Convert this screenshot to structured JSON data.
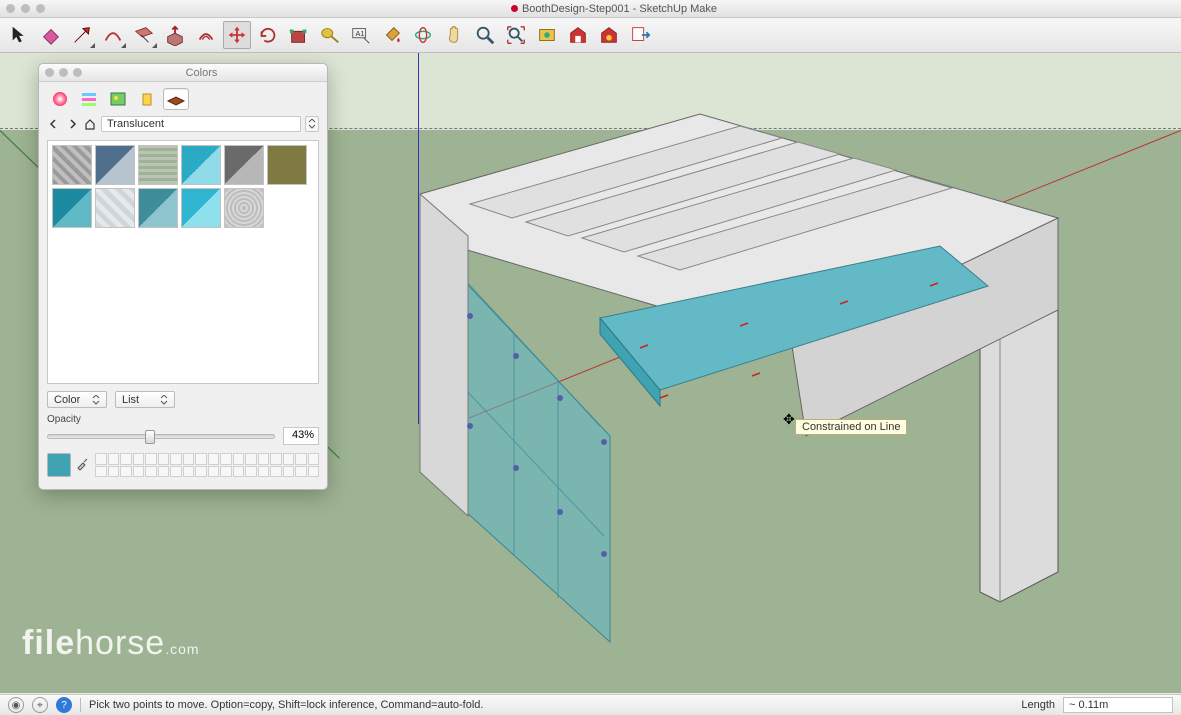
{
  "window": {
    "title": "BoothDesign-Step001 - SketchUp Make"
  },
  "toolbar": {
    "items": [
      {
        "name": "select-tool",
        "icon": "cursor",
        "active": false
      },
      {
        "name": "eraser-tool",
        "icon": "eraser"
      },
      {
        "name": "line-tool",
        "icon": "pencil",
        "corner": true
      },
      {
        "name": "arc-tool",
        "icon": "arc",
        "corner": true
      },
      {
        "name": "rectangle-tool",
        "icon": "rect",
        "corner": true
      },
      {
        "name": "push-pull-tool",
        "icon": "pushpull"
      },
      {
        "name": "offset-tool",
        "icon": "offset"
      },
      {
        "name": "move-tool",
        "icon": "move",
        "active": true
      },
      {
        "name": "rotate-tool",
        "icon": "rotate"
      },
      {
        "name": "scale-tool",
        "icon": "scale"
      },
      {
        "name": "tape-measure-tool",
        "icon": "tape"
      },
      {
        "name": "text-tool",
        "icon": "textA"
      },
      {
        "name": "paint-bucket-tool",
        "icon": "bucket"
      },
      {
        "name": "orbit-tool",
        "icon": "orbit"
      },
      {
        "name": "pan-tool",
        "icon": "pan"
      },
      {
        "name": "zoom-tool",
        "icon": "zoom"
      },
      {
        "name": "zoom-extents-tool",
        "icon": "zoomext"
      },
      {
        "name": "add-location-tool",
        "icon": "addloc"
      },
      {
        "name": "3d-warehouse-tool",
        "icon": "warehouse"
      },
      {
        "name": "extensions-tool",
        "icon": "ext"
      },
      {
        "name": "layout-tool",
        "icon": "layout"
      }
    ]
  },
  "viewport": {
    "tooltip": "Constrained on Line",
    "watermark": "filehorse.com"
  },
  "colors_panel": {
    "title": "Colors",
    "category": "Translucent",
    "picker_label_left": "Color",
    "picker_label_right": "List",
    "opacity_label": "Opacity",
    "opacity_value": "43%",
    "swatches_row1": [
      "#8c8c8c",
      "#6f8fb0",
      "#b8c6b3",
      "#55c3d8",
      "#8c8c8c",
      "#7f7a41"
    ],
    "swatches_row2": [
      "#2a9eb3",
      "#c8d0d4",
      "#5ea7b3",
      "#46c5dd",
      "#bdbdbd"
    ]
  },
  "status": {
    "hint": "Pick two points to move.  Option=copy, Shift=lock inference, Command=auto-fold.",
    "length_label": "Length",
    "length_value": "~ 0.11m"
  }
}
